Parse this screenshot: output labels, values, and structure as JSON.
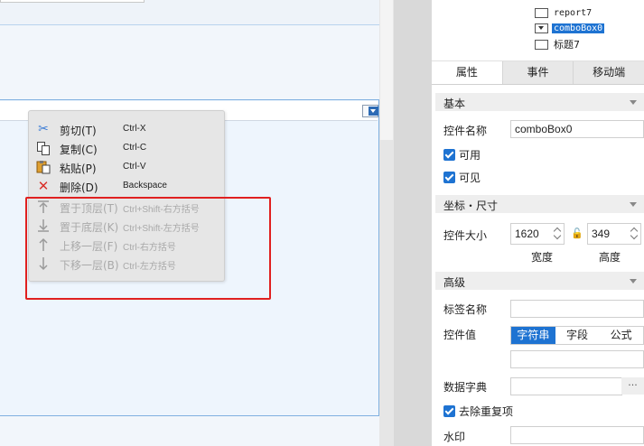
{
  "context_menu": {
    "items": [
      {
        "icon": "scissors-icon",
        "label": "剪切(T)",
        "shortcut": "Ctrl-X",
        "enabled": true
      },
      {
        "icon": "copy-icon",
        "label": "复制(C)",
        "shortcut": "Ctrl-C",
        "enabled": true
      },
      {
        "icon": "paste-icon",
        "label": "粘贴(P)",
        "shortcut": "Ctrl-V",
        "enabled": true
      },
      {
        "icon": "delete-icon",
        "label": "删除(D)",
        "shortcut": "Backspace",
        "enabled": true
      },
      {
        "icon": "bring-to-front-icon",
        "label": "置于顶层(T)",
        "shortcut": "Ctrl+Shift-右方括号",
        "enabled": false
      },
      {
        "icon": "send-to-back-icon",
        "label": "置于底层(K)",
        "shortcut": "Ctrl+Shift-左方括号",
        "enabled": false
      },
      {
        "icon": "move-up-icon",
        "label": "上移一层(F)",
        "shortcut": "Ctrl-右方括号",
        "enabled": false
      },
      {
        "icon": "move-down-icon",
        "label": "下移一层(B)",
        "shortcut": "Ctrl-左方括号",
        "enabled": false
      }
    ]
  },
  "tree": {
    "nodes": [
      {
        "label": "report7",
        "selected": false
      },
      {
        "label": "comboBox0",
        "selected": true
      },
      {
        "label": "标题7",
        "selected": false
      }
    ]
  },
  "tabs": [
    "属性",
    "事件",
    "移动端"
  ],
  "basic": {
    "section_title": "基本",
    "name_label": "控件名称",
    "name_value": "comboBox0",
    "enabled_label": "可用",
    "visible_label": "可见"
  },
  "position": {
    "section_title": "坐标・尺寸",
    "size_label": "控件大小",
    "width_value": "1620",
    "height_value": "349",
    "width_label": "宽度",
    "height_label": "高度"
  },
  "advanced": {
    "section_title": "高级",
    "tag_label": "标签名称",
    "tag_value": "",
    "control_value_label": "控件值",
    "value_types": [
      "字符串",
      "字段",
      "公式"
    ],
    "active_value_type": "字符串",
    "value_input": "",
    "dict_label": "数据字典",
    "dict_value": "",
    "dict_more": "···",
    "dedupe_label": "去除重复项",
    "watermark_label": "水印",
    "watermark_value": ""
  },
  "colors": {
    "accent": "#1e73d2",
    "highlight_box": "#e02020",
    "canvas_border": "#7fb0e0"
  }
}
